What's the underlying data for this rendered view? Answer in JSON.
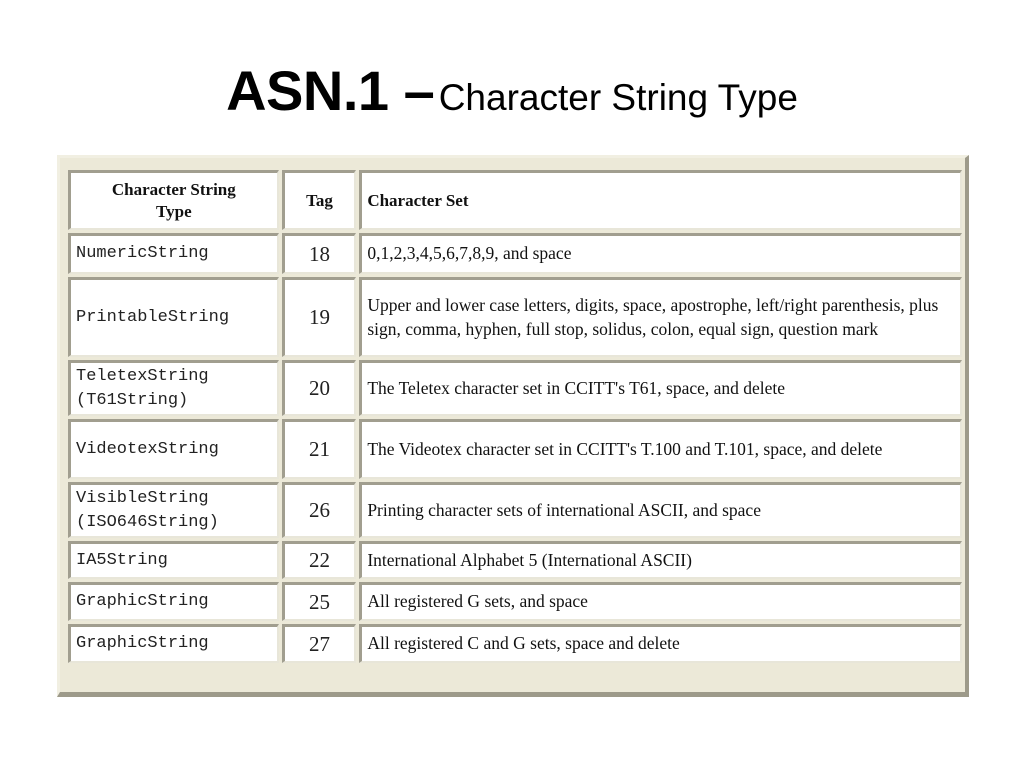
{
  "title": {
    "main": "ASN.1 –",
    "sub": "Character String Type"
  },
  "table": {
    "headers": {
      "type": "Character String Type",
      "tag": "Tag",
      "set": "Character Set"
    },
    "rows": [
      {
        "type": [
          "NumericString"
        ],
        "tag": "18",
        "set": "0,1,2,3,4,5,6,7,8,9, and space"
      },
      {
        "type": [
          "PrintableString"
        ],
        "tag": "19",
        "set": "Upper and lower case letters, digits, space, apostrophe, left/right parenthesis, plus sign, comma, hyphen, full stop, solidus, colon, equal sign, question mark"
      },
      {
        "type": [
          "TeletexString",
          "(T61String)"
        ],
        "tag": "20",
        "set": "The Teletex character set in CCITT's T61, space, and delete"
      },
      {
        "type": [
          "VideotexString"
        ],
        "tag": "21",
        "set": "The Videotex character set in CCITT's T.100 and T.101, space, and delete"
      },
      {
        "type": [
          "VisibleString",
          "(ISO646String)"
        ],
        "tag": "26",
        "set": "Printing character sets of international ASCII, and space"
      },
      {
        "type": [
          "IA5String"
        ],
        "tag": "22",
        "set": "International Alphabet 5 (International ASCII)"
      },
      {
        "type": [
          "GraphicString"
        ],
        "tag": "25",
        "set": "All registered G sets, and space"
      },
      {
        "type": [
          "GraphicString"
        ],
        "tag": "27",
        "set": "All registered C and G sets, space and delete"
      }
    ]
  }
}
